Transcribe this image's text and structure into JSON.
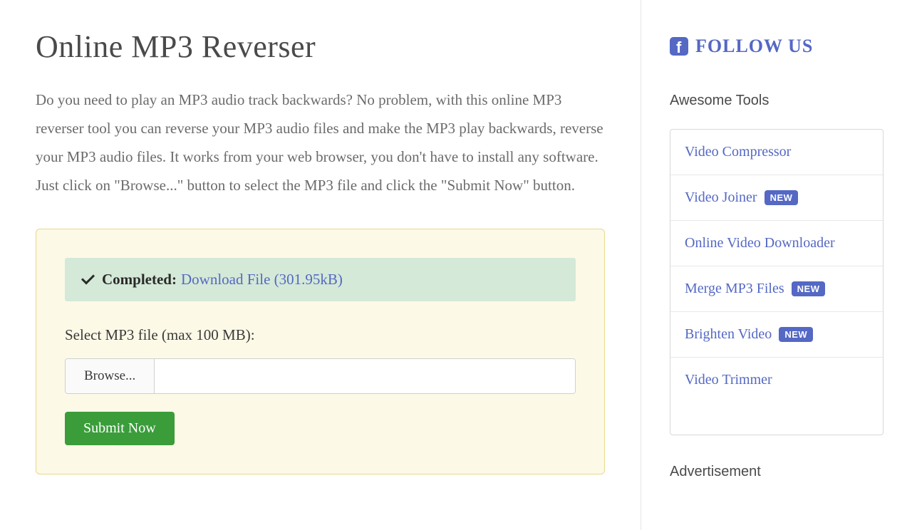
{
  "main": {
    "title": "Online MP3 Reverser",
    "description": "Do you need to play an MP3 audio track backwards? No problem, with this online MP3 reverser tool you can reverse your MP3 audio files and make the MP3 play backwards, reverse your MP3 audio files. It works from your web browser, you don't have to install any software. Just click on \"Browse...\" button to select the MP3 file and click the \"Submit Now\" button.",
    "status": {
      "label": "Completed:",
      "download_text": "Download File (301.95kB)"
    },
    "form": {
      "select_label": "Select MP3 file (max 100 MB):",
      "browse_label": "Browse...",
      "file_value": "",
      "submit_label": "Submit Now"
    }
  },
  "sidebar": {
    "follow_label": "FOLLOW US",
    "tools_header": "Awesome Tools",
    "tools": [
      {
        "label": "Video Compressor",
        "new": false
      },
      {
        "label": "Video Joiner",
        "new": true
      },
      {
        "label": "Online Video Downloader",
        "new": false
      },
      {
        "label": "Merge MP3 Files",
        "new": true
      },
      {
        "label": "Brighten Video",
        "new": true
      },
      {
        "label": "Video Trimmer",
        "new": false
      }
    ],
    "new_badge": "NEW",
    "ad_header": "Advertisement"
  }
}
